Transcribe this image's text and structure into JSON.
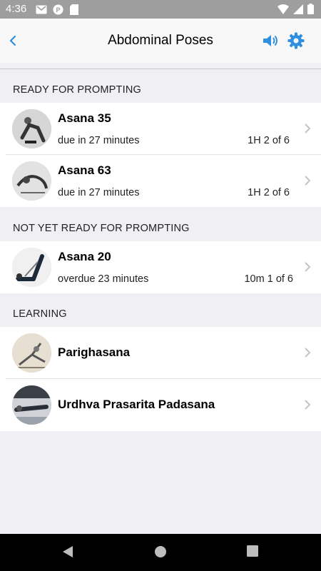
{
  "status_bar": {
    "time": "4:36"
  },
  "nav": {
    "title": "Abdominal Poses"
  },
  "sections": [
    {
      "header": "READY FOR PROMPTING",
      "items": [
        {
          "name": "Asana 35",
          "due": "due in 27 minutes",
          "count": "1H 2 of 6"
        },
        {
          "name": "Asana 63",
          "due": "due in 27 minutes",
          "count": "1H 2 of 6"
        }
      ]
    },
    {
      "header": "NOT YET READY FOR PROMPTING",
      "items": [
        {
          "name": "Asana 20",
          "due": "overdue 23 minutes",
          "count": "10m 1 of 6"
        }
      ]
    },
    {
      "header": "LEARNING",
      "items": [
        {
          "name": "Parighasana"
        },
        {
          "name": "Urdhva Prasarita Padasana"
        }
      ]
    }
  ],
  "colors": {
    "accent": "#2f8fe0",
    "status_bar": "#9e9e9e",
    "background": "#efeff4"
  }
}
